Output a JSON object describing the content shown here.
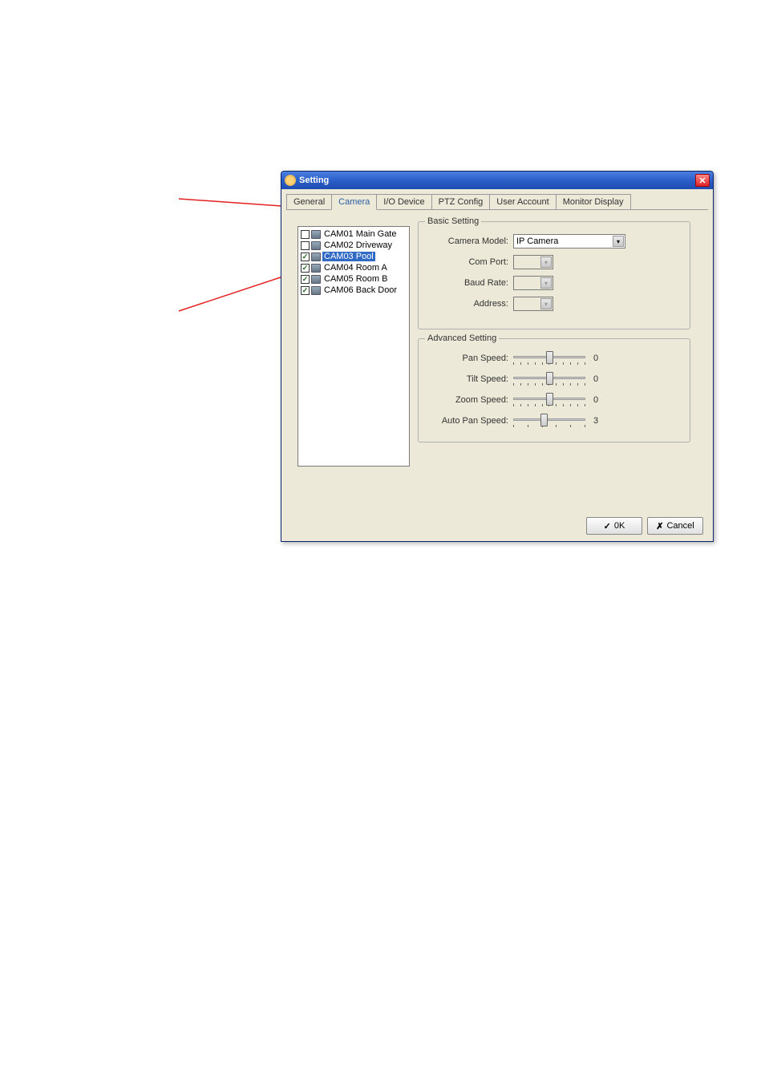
{
  "window": {
    "title": "Setting"
  },
  "tabs": [
    "General",
    "Camera",
    "I/O Device",
    "PTZ Config",
    "User Account",
    "Monitor Display"
  ],
  "active_tab": 1,
  "cameras": [
    {
      "label": "CAM01 Main Gate",
      "checked": false,
      "selected": false
    },
    {
      "label": "CAM02 Driveway",
      "checked": false,
      "selected": false
    },
    {
      "label": "CAM03 Pool",
      "checked": true,
      "selected": true
    },
    {
      "label": "CAM04 Room A",
      "checked": true,
      "selected": false
    },
    {
      "label": "CAM05 Room B",
      "checked": true,
      "selected": false
    },
    {
      "label": "CAM06 Back Door",
      "checked": true,
      "selected": false
    }
  ],
  "basic": {
    "legend": "Basic Setting",
    "camera_model_label": "Camera Model:",
    "camera_model_value": "IP Camera",
    "com_port_label": "Com Port:",
    "com_port_value": "",
    "baud_rate_label": "Baud Rate:",
    "baud_rate_value": "",
    "address_label": "Address:",
    "address_value": ""
  },
  "advanced": {
    "legend": "Advanced Setting",
    "pan_label": "Pan Speed:",
    "pan_value": "0",
    "tilt_label": "Tilt Speed:",
    "tilt_value": "0",
    "zoom_label": "Zoom Speed:",
    "zoom_value": "0",
    "auto_pan_label": "Auto Pan Speed:",
    "auto_pan_value": "3"
  },
  "buttons": {
    "ok": "0K",
    "cancel": "Cancel"
  }
}
